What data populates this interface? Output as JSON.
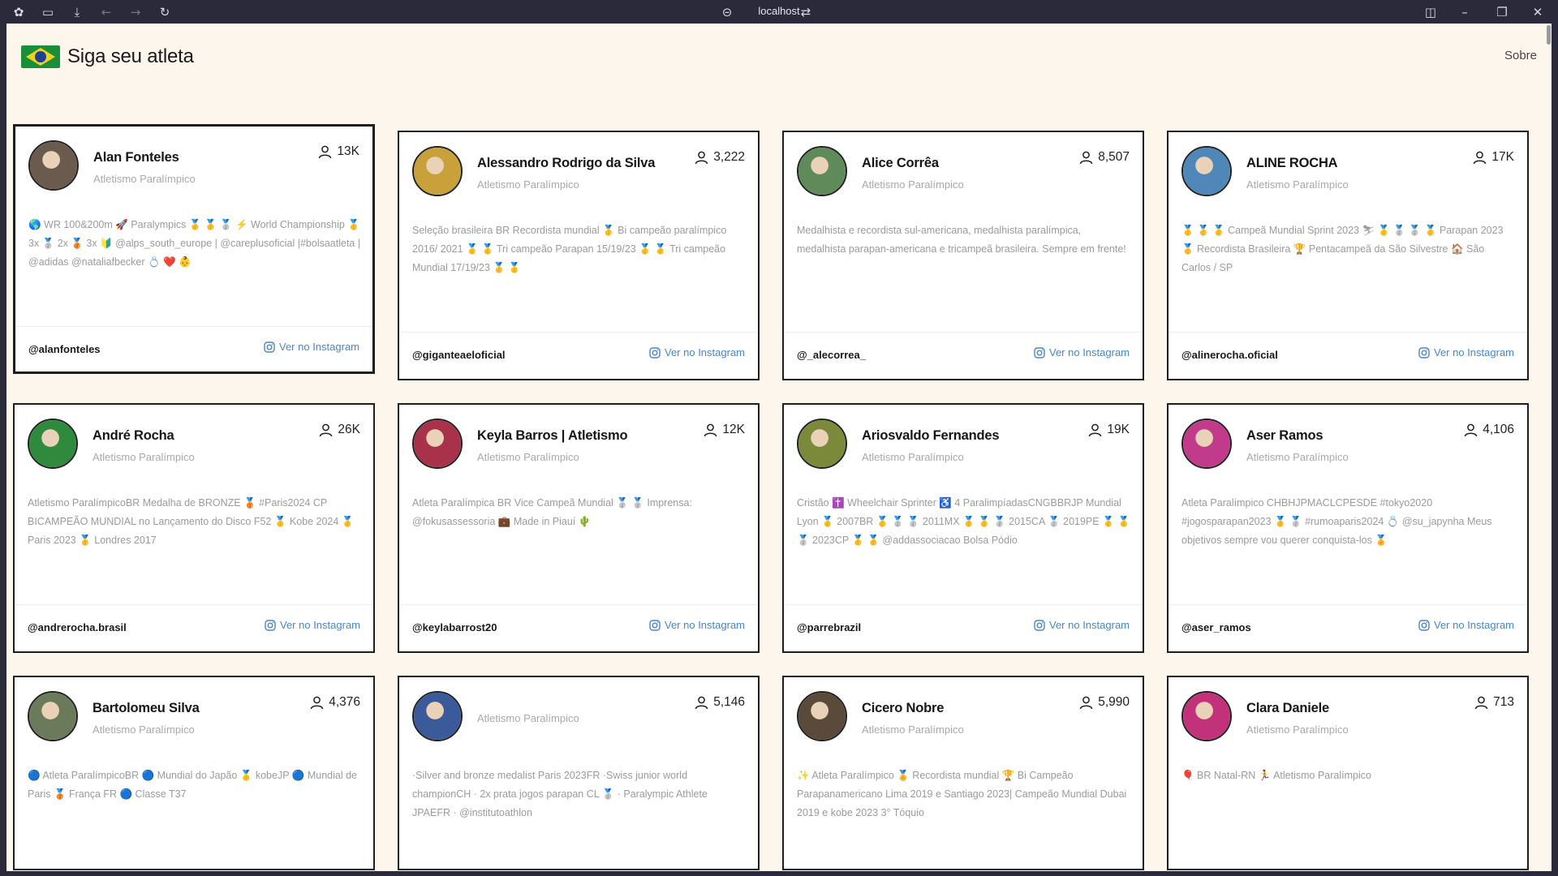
{
  "browser": {
    "url": "localhost"
  },
  "header": {
    "title": "Siga seu atleta",
    "about_link": "Sobre"
  },
  "common": {
    "insta_label": "Ver no Instagram"
  },
  "athletes": [
    {
      "name": "Alan Fonteles",
      "sport": "Atletismo Paralímpico",
      "followers": "13K",
      "bio": "🌎 WR 100&200m 🚀 Paralympics 🥇 🥇 🥈 ⚡ World Championship 🥇 3x 🥈 2x 🥉 3x 🔰 @alps_south_europe | @careplusoficial |#bolsaatleta | @adidas @nataliafbecker 💍 ❤️ 👶",
      "handle": "@alanfonteles",
      "avatar_color": "#6b5a4e"
    },
    {
      "name": "Alessandro Rodrigo da Silva",
      "sport": "Atletismo Paralímpico",
      "followers": "3,222",
      "bio": "Seleção brasileira BR Recordista mundial 🥇 Bi campeão paralímpico 2016/ 2021 🥇 🥇 Tri campeão Parapan 15/19/23 🥇 🥇 Tri campeão Mundial 17/19/23 🥇 🥇",
      "handle": "@giganteaeloficial",
      "avatar_color": "#c9a13a"
    },
    {
      "name": "Alice Corrêa",
      "sport": "Atletismo Paralímpico",
      "followers": "8,507",
      "bio": "Medalhista e recordista sul-americana, medalhista paralímpica, medalhista parapan-americana e tricampeã brasileira. Sempre em frente!",
      "handle": "@_alecorrea_",
      "avatar_color": "#5f8a5a"
    },
    {
      "name": "ALINE ROCHA",
      "sport": "Atletismo Paralímpico",
      "followers": "17K",
      "bio": "🥇 🥇 🥇 Campeã Mundial Sprint 2023 ⛷ 🥇 🥈 🥈 🥇 Parapan 2023 🥇 Recordista Brasileira 🏆 Pentacampeã da São Silvestre 🏠 São Carlos / SP",
      "handle": "@alinerocha.oficial",
      "avatar_color": "#4f87b8"
    },
    {
      "name": "André Rocha",
      "sport": "Atletismo Paralímpico",
      "followers": "26K",
      "bio": "Atletismo ParalímpicoBR Medalha de BRONZE 🥉 #Paris2024 CP BICAMPEÃO MUNDIAL no Lançamento do Disco F52 🥇 Kobe 2024 🥇 Paris 2023 🥇 Londres 2017",
      "handle": "@andrerocha.brasil",
      "avatar_color": "#2f8a3e"
    },
    {
      "name": "Keyla Barros | Atletismo",
      "sport": "Atletismo Paralímpico",
      "followers": "12K",
      "bio": "Atleta Paralímpica BR Vice Campeã Mundial 🥈 🥈 Imprensa: @fokusassessoria 💼 Made in Piauí 🌵",
      "handle": "@keylabarrost20",
      "avatar_color": "#a8324a"
    },
    {
      "name": "Ariosvaldo Fernandes",
      "sport": "Atletismo Paralímpico",
      "followers": "19K",
      "bio": "Cristão ✝️ Wheelchair Sprinter ♿ 4 ParalimpíadasCNGBBRJP Mundial Lyon 🥇 2007BR 🥇 🥈 🥈 2011MX 🥇 🥇 🥈 2015CA 🥈 2019PE 🥇 🥇 🥈 2023CP 🥇 🥇 @addassociacao Bolsa Pódio",
      "handle": "@parrebrazil",
      "avatar_color": "#7a8a3a"
    },
    {
      "name": "Aser Ramos",
      "sport": "Atletismo Paralímpico",
      "followers": "4,106",
      "bio": "Atleta Paralímpico CHBHJPMACLCPESDE #tokyo2020 #jogosparapan2023 🥇 🥈 #rumoaparis2024 💍 @su_japynha Meus objetivos sempre vou querer conquista-los 🏅",
      "handle": "@aser_ramos",
      "avatar_color": "#c23a8a"
    },
    {
      "name": "Bartolomeu Silva",
      "sport": "Atletismo Paralímpico",
      "followers": "4,376",
      "bio": "🔵 Atleta ParalímpicoBR 🔵 Mundial do Japão 🥇 kobeJP 🔵 Mundial de Paris 🥉 França FR 🔵 Classe T37",
      "handle": "",
      "avatar_color": "#6a7a5a"
    },
    {
      "name": "",
      "sport": "Atletismo Paralímpico",
      "followers": "5,146",
      "bio": "·Silver and bronze medalist Paris 2023FR ·Swiss junior world championCH · 2x prata jogos parapan CL 🥈 · Paralympic Athlete JPAEFR · @institutoathlon",
      "handle": "",
      "avatar_color": "#3a5a9a"
    },
    {
      "name": "Cicero Nobre",
      "sport": "Atletismo Paralímpico",
      "followers": "5,990",
      "bio": "✨ Atleta Paralímpico 🏅 Recordista mundial 🏆 Bi Campeão Parapanamericano Lima 2019 e Santiago 2023| Campeão Mundial Dubai 2019 e kobe 2023 3° Tóquio",
      "handle": "",
      "avatar_color": "#5a4a3a"
    },
    {
      "name": "Clara Daniele",
      "sport": "Atletismo Paralímpico",
      "followers": "713",
      "bio": "🎈 BR Natal-RN 🏃 Atletismo Paralímpico",
      "handle": "",
      "avatar_color": "#c2327a"
    }
  ]
}
